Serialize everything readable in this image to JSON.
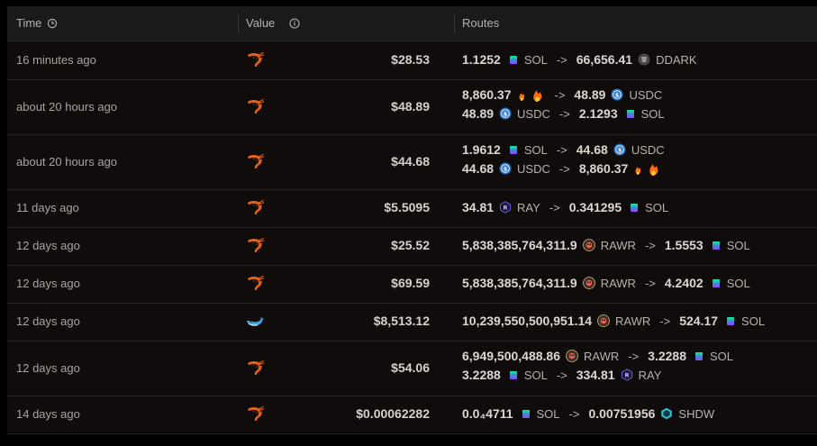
{
  "header": {
    "time_label": "Time",
    "value_label": "Value",
    "routes_label": "Routes"
  },
  "rows": [
    {
      "time": "16 minutes ago",
      "value": "$28.53",
      "icon": "shrimp-icon",
      "routes": [
        {
          "from_amt": "1.1252",
          "from_sym": "SOL",
          "from_tok": "sol",
          "to_amt": "66,656.41",
          "to_sym": "DDARK",
          "to_tok": "ddark"
        }
      ]
    },
    {
      "time": "about 20 hours ago",
      "value": "$48.89",
      "icon": "shrimp-icon",
      "routes": [
        {
          "from_amt": "8,860.37",
          "from_sym": "",
          "from_tok": "fire",
          "to_amt": "48.89",
          "to_sym": "USDC",
          "to_tok": "usdc"
        },
        {
          "from_amt": "48.89",
          "from_sym": "USDC",
          "from_tok": "usdc",
          "to_amt": "2.1293",
          "to_sym": "SOL",
          "to_tok": "sol"
        }
      ]
    },
    {
      "time": "about 20 hours ago",
      "value": "$44.68",
      "icon": "shrimp-icon",
      "routes": [
        {
          "from_amt": "1.9612",
          "from_sym": "SOL",
          "from_tok": "sol",
          "to_amt": "44.68",
          "to_sym": "USDC",
          "to_tok": "usdc"
        },
        {
          "from_amt": "44.68",
          "from_sym": "USDC",
          "from_tok": "usdc",
          "to_amt": "8,860.37",
          "to_sym": "",
          "to_tok": "fire"
        }
      ]
    },
    {
      "time": "11 days ago",
      "value": "$5.5095",
      "icon": "shrimp-icon",
      "routes": [
        {
          "from_amt": "34.81",
          "from_sym": "RAY",
          "from_tok": "ray",
          "to_amt": "0.341295",
          "to_sym": "SOL",
          "to_tok": "sol"
        }
      ]
    },
    {
      "time": "12 days ago",
      "value": "$25.52",
      "icon": "shrimp-icon",
      "routes": [
        {
          "from_amt": "5,838,385,764,311.9",
          "from_sym": "RAWR",
          "from_tok": "rawr",
          "to_amt": "1.5553",
          "to_sym": "SOL",
          "to_tok": "sol"
        }
      ]
    },
    {
      "time": "12 days ago",
      "value": "$69.59",
      "icon": "shrimp-icon",
      "routes": [
        {
          "from_amt": "5,838,385,764,311.9",
          "from_sym": "RAWR",
          "from_tok": "rawr",
          "to_amt": "4.2402",
          "to_sym": "SOL",
          "to_tok": "sol"
        }
      ]
    },
    {
      "time": "12 days ago",
      "value": "$8,513.12",
      "icon": "whale-icon",
      "routes": [
        {
          "from_amt": "10,239,550,500,951.14",
          "from_sym": "RAWR",
          "from_tok": "rawr",
          "to_amt": "524.17",
          "to_sym": "SOL",
          "to_tok": "sol"
        }
      ]
    },
    {
      "time": "12 days ago",
      "value": "$54.06",
      "icon": "shrimp-icon",
      "routes": [
        {
          "from_amt": "6,949,500,488.86",
          "from_sym": "RAWR",
          "from_tok": "rawr",
          "to_amt": "3.2288",
          "to_sym": "SOL",
          "to_tok": "sol"
        },
        {
          "from_amt": "3.2288",
          "from_sym": "SOL",
          "from_tok": "sol",
          "to_amt": "334.81",
          "to_sym": "RAY",
          "to_tok": "ray"
        }
      ]
    },
    {
      "time": "14 days ago",
      "value": "$0.00062282",
      "icon": "shrimp-icon",
      "routes": [
        {
          "from_amt": "0.0₄4711",
          "from_sym": "SOL",
          "from_tok": "sol",
          "to_amt": "0.00751956",
          "to_sym": "SHDW",
          "to_tok": "shdw"
        }
      ]
    }
  ],
  "arrow": "->",
  "colors": {
    "shrimp": "#e8621a",
    "usdc": "#2775ca",
    "ray": "#5a4fcf",
    "whale": "#3a9fe0"
  }
}
